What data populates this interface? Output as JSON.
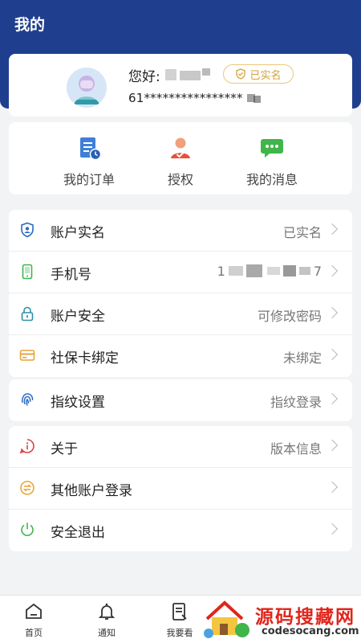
{
  "header": {
    "title": "我的"
  },
  "profile": {
    "greeting": "您好:",
    "verified_badge": "已实名",
    "id_number": "61****************"
  },
  "quick_actions": [
    {
      "label": "我的订单",
      "icon": "order-doc-icon"
    },
    {
      "label": "授权",
      "icon": "person-check-icon"
    },
    {
      "label": "我的消息",
      "icon": "chat-bubble-icon"
    }
  ],
  "account_group": [
    {
      "label": "账户实名",
      "value": "已实名",
      "icon": "shield-id-icon"
    },
    {
      "label": "手机号",
      "value": "1",
      "value_tail": "7",
      "icon": "phone-icon"
    },
    {
      "label": "账户安全",
      "value": "可修改密码",
      "icon": "lock-icon"
    },
    {
      "label": "社保卡绑定",
      "value": "未绑定",
      "icon": "card-icon"
    }
  ],
  "fingerprint_group": [
    {
      "label": "指纹设置",
      "value": "指纹登录",
      "icon": "fingerprint-icon"
    }
  ],
  "other_group": [
    {
      "label": "关于",
      "value": "版本信息",
      "icon": "info-icon"
    },
    {
      "label": "其他账户登录",
      "value": "",
      "icon": "switch-account-icon"
    },
    {
      "label": "安全退出",
      "value": "",
      "icon": "power-icon"
    }
  ],
  "tabbar": [
    {
      "label": "首页",
      "icon": "home-icon"
    },
    {
      "label": "通知",
      "icon": "bell-icon"
    },
    {
      "label": "我要看",
      "icon": "document-icon"
    }
  ],
  "watermark": {
    "title": "源码搜藏网",
    "subtitle": "codesocang.com"
  },
  "colors": {
    "header": "#1f3f8e",
    "badge": "#d4a23b",
    "chevron": "#b8b8b8"
  }
}
